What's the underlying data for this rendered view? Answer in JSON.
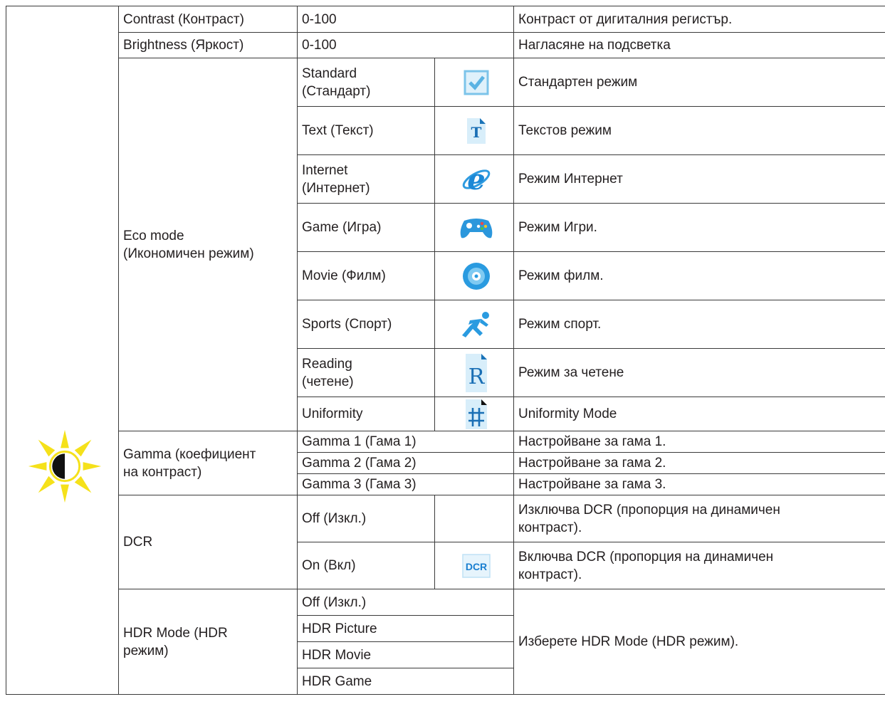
{
  "rows": {
    "contrast": {
      "label": "Contrast (Контраст)",
      "range": "0-100",
      "desc": "Контраст от дигиталния регистър."
    },
    "brightness": {
      "label": "Brightness (Яркост)",
      "range": "0-100",
      "desc": "Нагласяне на подсветка"
    },
    "eco": {
      "label_line1": "Eco mode",
      "label_line2": "(Икономичен режим)",
      "modes": [
        {
          "name_line1": "Standard",
          "name_line2": "(Стандарт)",
          "icon": "checkbox-icon",
          "desc": "Стандартен режим"
        },
        {
          "name_line1": "Text (Текст)",
          "name_line2": "",
          "icon": "text-document-icon",
          "desc": "Текстов режим"
        },
        {
          "name_line1": "Internet",
          "name_line2": "(Интернет)",
          "icon": "internet-explorer-icon",
          "desc": "Режим Интернет"
        },
        {
          "name_line1": "Game (Игра)",
          "name_line2": "",
          "icon": "gamepad-icon",
          "desc": "Режим Игри."
        },
        {
          "name_line1": "Movie (Филм)",
          "name_line2": "",
          "icon": "disc-icon",
          "desc": "Режим филм."
        },
        {
          "name_line1": "Sports (Спорт)",
          "name_line2": "",
          "icon": "runner-icon",
          "desc": "Режим спорт."
        },
        {
          "name_line1": "Reading",
          "name_line2": "(четене)",
          "icon": "reading-document-icon",
          "desc": "Режим за четене"
        },
        {
          "name_line1": "Uniformity",
          "name_line2": "",
          "icon": "grid-document-icon",
          "desc": "Uniformity Mode"
        }
      ]
    },
    "gamma": {
      "label_line1": "Gamma (коефициент",
      "label_line2": "на контраст)",
      "options": [
        {
          "name": "Gamma 1 (Гама 1)",
          "desc": "Настройване за гама 1."
        },
        {
          "name": "Gamma 2 (Гама 2)",
          "desc": "Настройване за гама 2."
        },
        {
          "name": "Gamma 3 (Гама 3)",
          "desc": "Настройване за гама 3."
        }
      ]
    },
    "dcr": {
      "label": "DCR",
      "options": [
        {
          "name": "Off (Изкл.)",
          "desc_line1": "Изключва DCR (пропорция на динамичен",
          "desc_line2": "контраст)."
        },
        {
          "name": "On (Вкл)",
          "icon": "dcr-icon",
          "icon_text": "DCR",
          "desc_line1": "Включва DCR (пропорция на динамичен",
          "desc_line2": "контраст)."
        }
      ]
    },
    "hdr": {
      "label_line1": "HDR Mode (HDR",
      "label_line2": "режим)",
      "options": [
        "Off (Изкл.)",
        "HDR Picture",
        "HDR Movie",
        "HDR Game"
      ],
      "desc": "Изберете HDR Mode (HDR режим)."
    }
  },
  "colors": {
    "sun": "#f5e11a",
    "icon_blue": "#1a8fd8",
    "border": "#3a3a3a"
  },
  "section_icon": "brightness-contrast-sun-icon"
}
